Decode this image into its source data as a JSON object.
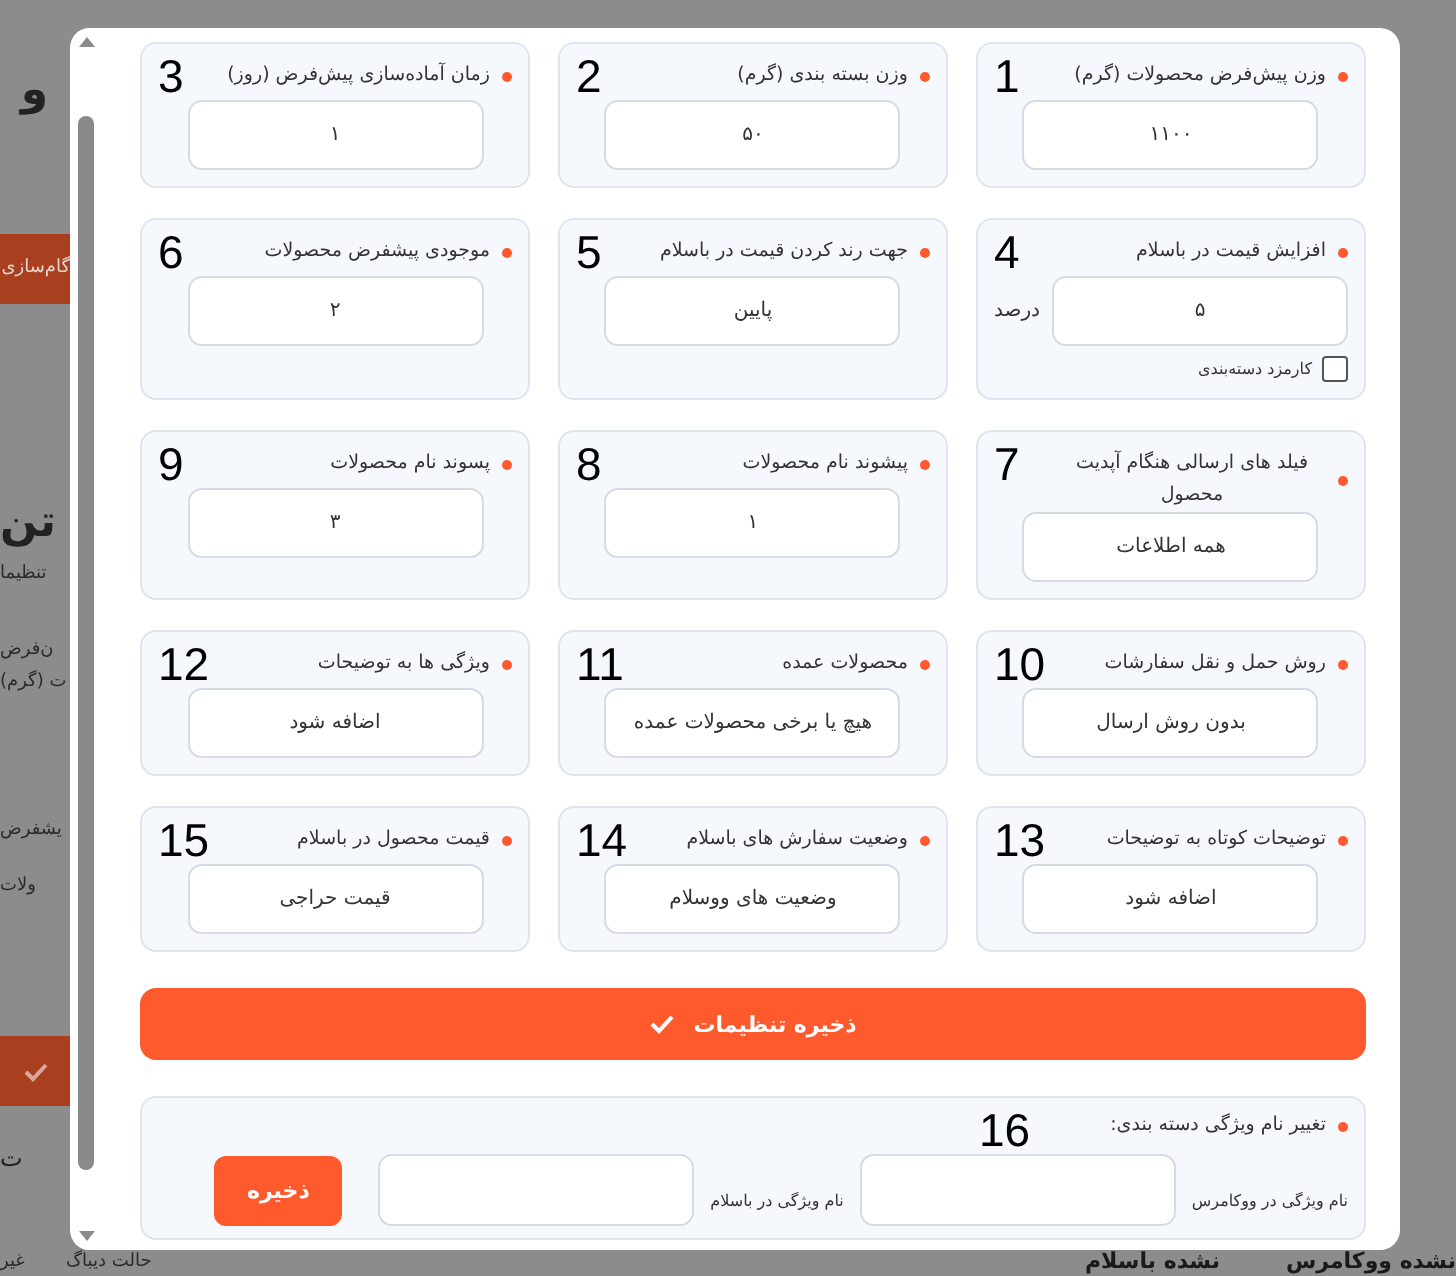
{
  "background": {
    "fragments": [
      {
        "kind": "heading",
        "text": "و"
      },
      {
        "kind": "button",
        "text": "گام‌سازی"
      },
      {
        "kind": "heading",
        "text": "تن"
      },
      {
        "kind": "text",
        "text": "تنظیما"
      },
      {
        "kind": "text",
        "text": "ن‌فرض"
      },
      {
        "kind": "text",
        "text": "ت (گرم)"
      },
      {
        "kind": "text",
        "text": "یشفرض"
      },
      {
        "kind": "text",
        "text": "ولات"
      },
      {
        "kind": "toggle",
        "text": "ت"
      },
      {
        "kind": "column",
        "text": "نشده ووکامرس"
      },
      {
        "kind": "column",
        "text": "نشده باسلام"
      },
      {
        "kind": "text",
        "text": "حالت دیباگ"
      },
      {
        "kind": "text",
        "text": "غیر"
      }
    ]
  },
  "modal": {
    "fields": [
      {
        "number": "1",
        "label": "وزن پیش‌فرض محصولات (گرم)",
        "value": "۱۱۰۰"
      },
      {
        "number": "2",
        "label": "وزن بسته بندی (گرم)",
        "value": "۵۰"
      },
      {
        "number": "3",
        "label": "زمان آماده‌سازی پیش‌فرض (روز)",
        "value": "۱"
      },
      {
        "number": "4",
        "label": "افزایش قیمت در باسلام",
        "value": "۵",
        "unit": "درصد",
        "checkbox": {
          "label": "کارمزد دسته‌بندی",
          "checked": false
        }
      },
      {
        "number": "5",
        "label": "جهت رند کردن قیمت در باسلام",
        "value": "پایین"
      },
      {
        "number": "6",
        "label": "موجودی پیشفرض محصولات",
        "value": "۲"
      },
      {
        "number": "7",
        "label": "فیلد های ارسالی هنگام آپدیت محصول",
        "value": "همه اطلاعات"
      },
      {
        "number": "8",
        "label": "پیشوند نام محصولات",
        "value": "۱"
      },
      {
        "number": "9",
        "label": "پسوند نام محصولات",
        "value": "۳"
      },
      {
        "number": "10",
        "label": "روش حمل و نقل سفارشات",
        "value": "بدون روش ارسال"
      },
      {
        "number": "11",
        "label": "محصولات عمده",
        "value": "هیچ یا برخی محصولات عمده"
      },
      {
        "number": "12",
        "label": "ویژگی ها به توضیحات",
        "value": "اضافه شود"
      },
      {
        "number": "13",
        "label": "توضیحات کوتاه به توضیحات",
        "value": "اضافه شود"
      },
      {
        "number": "14",
        "label": "وضعیت سفارش های باسلام",
        "value": "وضعیت های ووسلام"
      },
      {
        "number": "15",
        "label": "قیمت محصول در باسلام",
        "value": "قیمت حراجی"
      }
    ],
    "save_button": "ذخیره تنظیمات",
    "rename": {
      "number": "16",
      "title": "تغییر نام ویژگی دسته بندی:",
      "woo_label": "نام ویژگی در ووکامرس",
      "basalam_label": "نام ویژگی در باسلام",
      "button": "ذخیره"
    }
  }
}
